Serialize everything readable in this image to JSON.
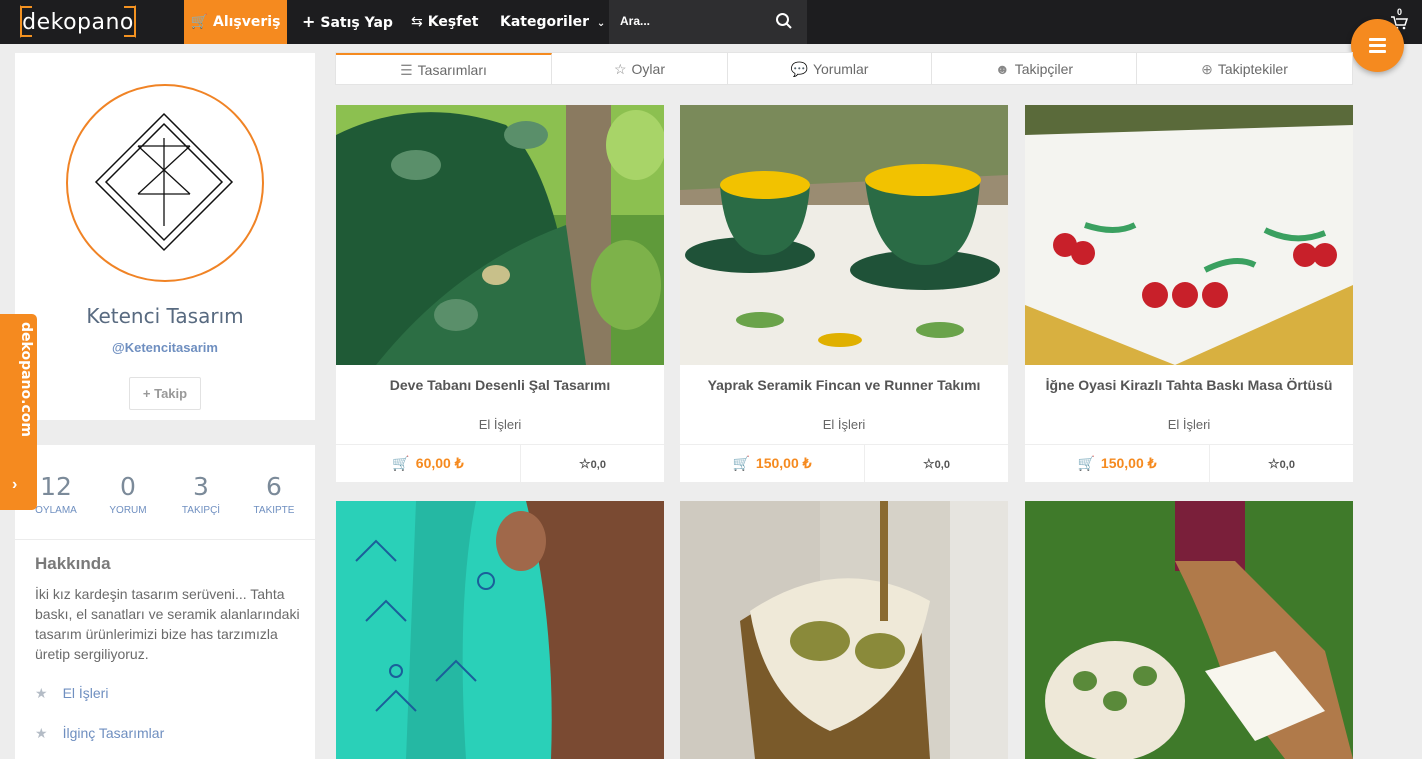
{
  "brand": {
    "logo_text": "dekopano"
  },
  "nav": {
    "shopping": "Alışveriş",
    "sell": "Satış Yap",
    "explore": "Keşfet",
    "categories": "Kategoriler",
    "search_placeholder": "Ara...",
    "cart_count": "0"
  },
  "sidetab": {
    "label": "dekopano.com",
    "arrow": "›"
  },
  "colors": {
    "accent": "#f58a1f",
    "topbar": "#1d1d1f",
    "link": "#6f8fc0"
  },
  "profile": {
    "name": "Ketenci Tasarım",
    "handle": "@Ketencitasarim",
    "follow_label": "+ Takip",
    "stats": [
      {
        "value": "12",
        "label": "OYLAMA"
      },
      {
        "value": "0",
        "label": "YORUM"
      },
      {
        "value": "3",
        "label": "TAKIPÇİ"
      },
      {
        "value": "6",
        "label": "TAKIPTE"
      }
    ],
    "about_title": "Hakkında",
    "about_text": "İki kız kardeşin tasarım serüveni... Tahta baskı, el sanatları ve seramik alanlarındaki tasarım ürünlerimizi bize has tarzımızla üretip sergiliyoruz.",
    "categories": [
      "El İşleri",
      "İlginç Tasarımlar"
    ]
  },
  "tabs": [
    {
      "label": "Tasarımları",
      "icon": "layers-icon"
    },
    {
      "label": "Oylar",
      "icon": "star-icon"
    },
    {
      "label": "Yorumlar",
      "icon": "comments-icon"
    },
    {
      "label": "Takipçiler",
      "icon": "user-icon"
    },
    {
      "label": "Takiptekiler",
      "icon": "plus-circle-icon"
    }
  ],
  "products": [
    {
      "title": "Deve Tabanı Desenli Şal Tasarımı",
      "category": "El İşleri",
      "price": "60,00 ₺",
      "rating": "0,0"
    },
    {
      "title": "Yaprak Seramik Fincan ve Runner Takımı",
      "category": "El İşleri",
      "price": "150,00 ₺",
      "rating": "0,0"
    },
    {
      "title": "İğne Oyasi Kirazlı Tahta Baskı Masa Örtüsü",
      "category": "El İşleri",
      "price": "150,00 ₺",
      "rating": "0,0"
    }
  ]
}
